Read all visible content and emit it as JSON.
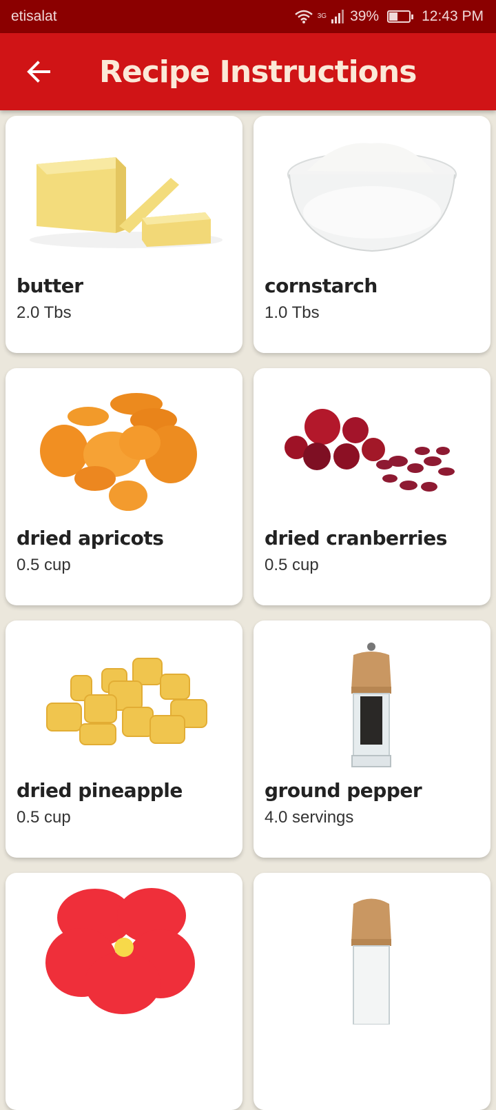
{
  "status": {
    "carrier": "etisalat",
    "network": "3G",
    "battery": "39%",
    "time": "12:43 PM"
  },
  "header": {
    "title": "Recipe Instructions"
  },
  "ingredients": [
    {
      "name": "butter",
      "qty": "2.0 Tbs",
      "icon": "butter-image"
    },
    {
      "name": "cornstarch",
      "qty": "1.0 Tbs",
      "icon": "cornstarch-image"
    },
    {
      "name": "dried apricots",
      "qty": "0.5 cup",
      "icon": "apricots-image"
    },
    {
      "name": "dried cranberries",
      "qty": "0.5 cup",
      "icon": "cranberries-image"
    },
    {
      "name": "dried pineapple",
      "qty": "0.5 cup",
      "icon": "pineapple-image"
    },
    {
      "name": "ground pepper",
      "qty": "4.0 servings",
      "icon": "pepper-grinder-image"
    },
    {
      "name": "",
      "qty": "",
      "icon": "hibiscus-image"
    },
    {
      "name": "",
      "qty": "",
      "icon": "salt-grinder-image"
    }
  ],
  "colors": {
    "appbar": "#d01416",
    "statusbar": "#8b0000",
    "background": "#ebe7dc"
  }
}
